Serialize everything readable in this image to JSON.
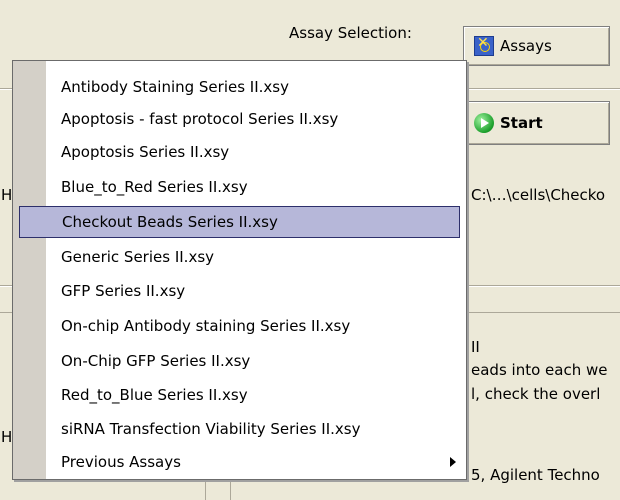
{
  "header": {
    "assay_selection_label": "Assay Selection:",
    "assays_button_label": "Assays",
    "start_button_label": "Start"
  },
  "background_text": {
    "path_fragment": "C:\\…\\cells\\Checko",
    "roman_fragment": "II",
    "line1_fragment": "eads into each we",
    "line2_fragment": "l, check the overl",
    "footer_fragment": "5, Agilent Techno",
    "edge_h1": "H",
    "edge_h2": "H"
  },
  "menu": {
    "items": [
      {
        "label": "Antibody Staining Series II.xsy"
      },
      {
        "label": "Apoptosis - fast protocol Series II.xsy"
      },
      {
        "label": "Apoptosis Series II.xsy"
      },
      {
        "label": "Blue_to_Red Series II.xsy"
      },
      {
        "label": "Checkout Beads Series II.xsy",
        "selected": true
      },
      {
        "label": "Generic Series II.xsy"
      },
      {
        "label": "GFP Series II.xsy"
      },
      {
        "label": "On-chip Antibody staining Series II.xsy"
      },
      {
        "label": "On-Chip GFP Series II.xsy"
      },
      {
        "label": "Red_to_Blue Series II.xsy"
      },
      {
        "label": "siRNA Transfection Viability Series II.xsy"
      },
      {
        "label": "Previous Assays",
        "has_submenu": true
      }
    ]
  },
  "colors": {
    "window_bg": "#ece9d8",
    "menu_bg": "#ffffff",
    "menu_gutter": "#d4d0c8",
    "selection_bg": "#b6b7d9",
    "selection_border": "#2d2f6b"
  }
}
